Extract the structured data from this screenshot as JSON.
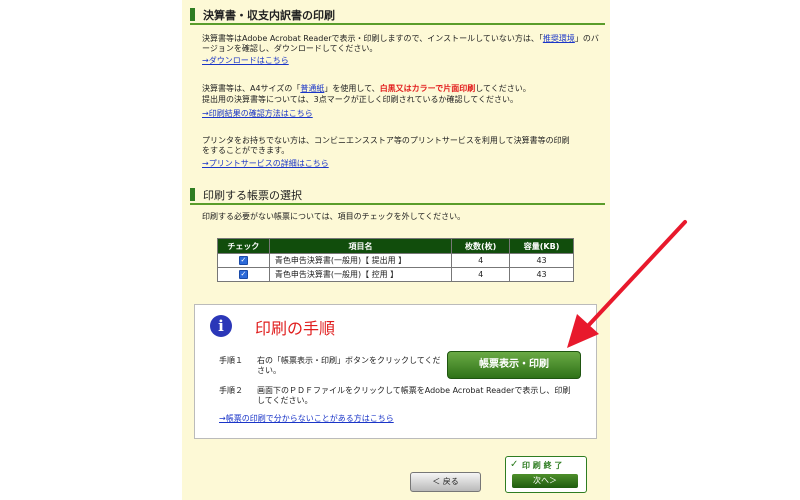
{
  "section1": {
    "title": "決算書・収支内訳書の印刷",
    "para1_a": "決算書等はAdobe Acrobat Readerで表示・印刷しますので、インストールしていない方は、「",
    "para1_link": "推奨環境",
    "para1_b": "」のバージョンを確認し、ダウンロードしてください。",
    "download_link": "→ダウンロードはこちら",
    "para2_a": "決算書等は、A4サイズの「",
    "para2_link": "普通紙",
    "para2_b": "」を使用して、",
    "para2_red": "白黒又はカラーで片面印刷",
    "para2_c": "してください。",
    "para2_line2": "提出用の決算書等については、3点マークが正しく印刷されているか確認してください。",
    "confirm_link": "→印刷結果の確認方法はこちら",
    "para3": "プリンタをお持ちでない方は、コンビニエンスストア等のプリントサービスを利用して決算書等の印刷をすることができます。",
    "print_service_link": "→プリントサービスの詳細はこちら"
  },
  "section2": {
    "title": "印刷する帳票の選択",
    "desc": "印刷する必要がない帳票については、項目のチェックを外してください。",
    "headers": [
      "チェック",
      "項目名",
      "枚数(枚)",
      "容量(KB)"
    ],
    "rows": [
      {
        "checked": "✓",
        "name": "青色申告決算書(一般用)【 提出用 】",
        "pages": "4",
        "size": "43"
      },
      {
        "checked": "✓",
        "name": "青色申告決算書(一般用)【 控用 】",
        "pages": "4",
        "size": "43"
      }
    ]
  },
  "panel": {
    "info_glyph": "i",
    "title": "印刷の手順",
    "step1_label": "手順１",
    "step1_text": "右の「帳票表示・印刷」ボタンをクリックしてください。",
    "step2_label": "手順２",
    "step2_text": "画面下のＰＤＦファイルをクリックして帳票をAdobe Acrobat Readerで表示し、印刷してください。",
    "help_link": "→帳票の印刷で分からないことがある方はこちら",
    "show_print_button": "帳票表示・印刷"
  },
  "footer": {
    "back_label": "＜ 戻る",
    "finish_label": "印 刷 終 了",
    "next_label": "次へ＞"
  },
  "colors": {
    "accent_green": "#2f7d22",
    "table_header": "#114d0c",
    "alert_red": "#e21b1b",
    "link_blue": "#1a35c8",
    "arrow_red": "#e8192c"
  },
  "icons": {
    "info": "info-icon",
    "check": "check-icon",
    "arrow": "red-arrow-icon"
  }
}
